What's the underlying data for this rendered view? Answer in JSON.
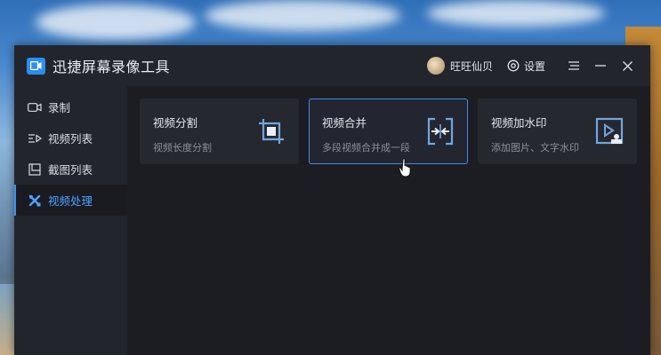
{
  "app": {
    "title": "迅捷屏幕录像工具",
    "accent": "#2b8ef0"
  },
  "titlebar": {
    "user_name": "旺旺仙贝",
    "settings_label": "设置",
    "menu_icon": "hamburger-icon",
    "minimize_icon": "minimize-icon",
    "close_icon": "close-icon"
  },
  "sidebar": {
    "items": [
      {
        "label": "录制",
        "icon": "camera-icon",
        "active": false
      },
      {
        "label": "视频列表",
        "icon": "video-list-icon",
        "active": false
      },
      {
        "label": "截图列表",
        "icon": "screenshot-list-icon",
        "active": false
      },
      {
        "label": "视频处理",
        "icon": "tools-icon",
        "active": true
      }
    ]
  },
  "cards": [
    {
      "title": "视频分割",
      "desc": "视频长度分割",
      "icon": "crop-icon",
      "selected": false
    },
    {
      "title": "视频合并",
      "desc": "多段视频合并成一段",
      "icon": "merge-icon",
      "selected": true
    },
    {
      "title": "视频加水印",
      "desc": "添加图片、文字水印",
      "icon": "watermark-icon",
      "selected": false
    }
  ]
}
